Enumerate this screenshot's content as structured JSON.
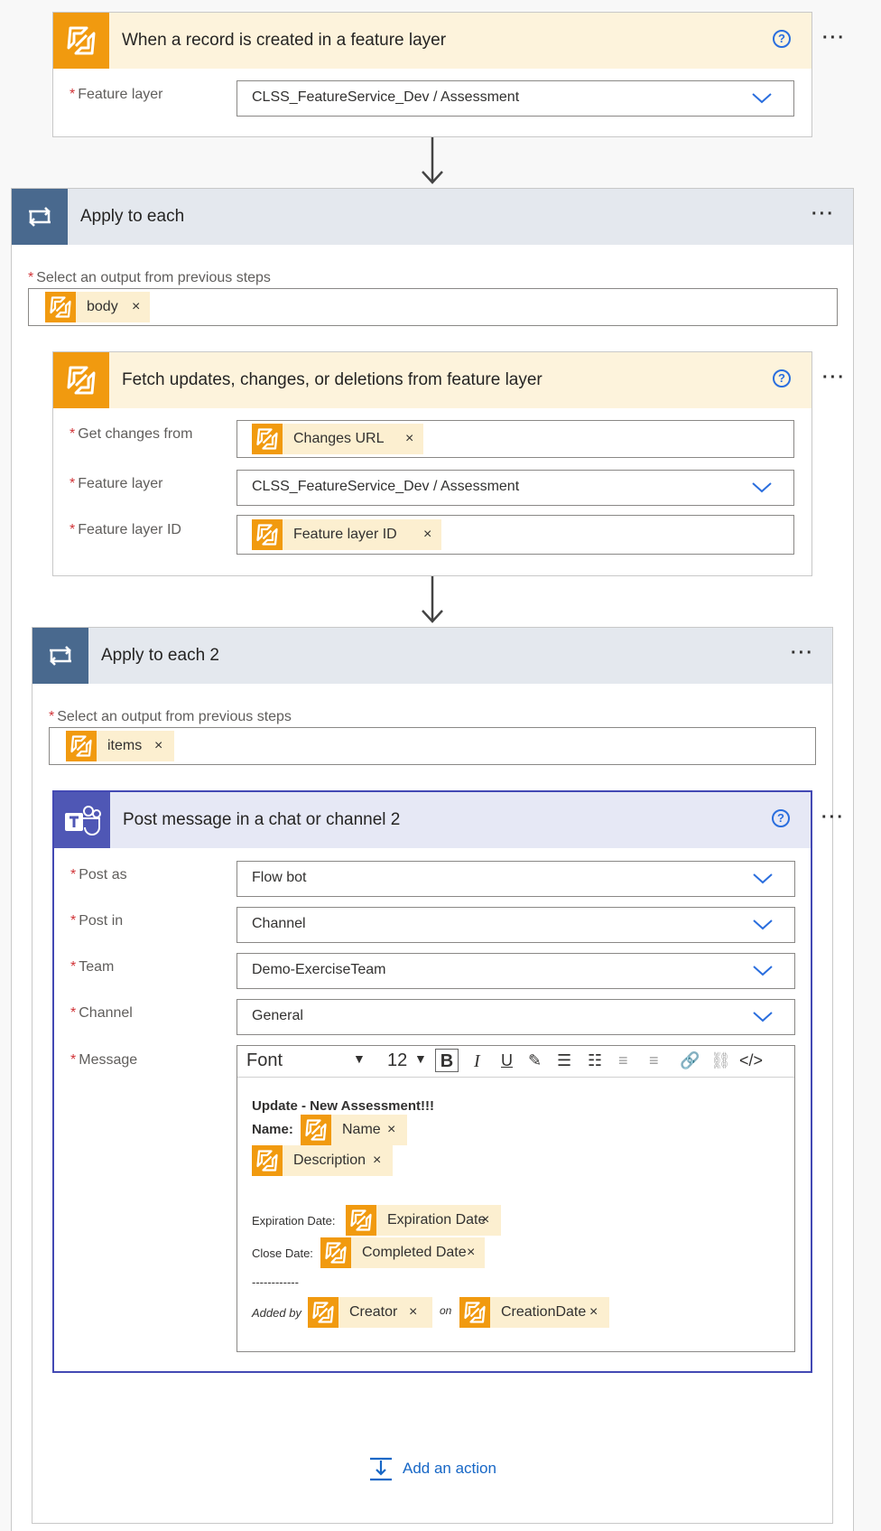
{
  "trigger": {
    "title": "When a record is created in a feature layer",
    "fields": [
      {
        "label": "Feature layer",
        "value": "CLSS_FeatureService_Dev / Assessment"
      }
    ]
  },
  "apply_each": {
    "title": "Apply to each",
    "select_label": "Select an output from previous steps",
    "token": "body"
  },
  "fetch": {
    "title": "Fetch updates, changes, or deletions from feature layer",
    "fields": [
      {
        "label": "Get changes from",
        "token": "Changes URL"
      },
      {
        "label": "Feature layer",
        "value": "CLSS_FeatureService_Dev / Assessment"
      },
      {
        "label": "Feature layer ID",
        "token": "Feature layer ID"
      }
    ]
  },
  "apply_each2": {
    "title": "Apply to each 2",
    "select_label": "Select an output from previous steps",
    "token": "items"
  },
  "post": {
    "title": "Post message in a chat or channel 2",
    "fields": [
      {
        "label": "Post as",
        "value": "Flow bot"
      },
      {
        "label": "Post in",
        "value": "Channel"
      },
      {
        "label": "Team",
        "value": "Demo-ExerciseTeam"
      },
      {
        "label": "Channel",
        "value": "General"
      }
    ],
    "message_label": "Message",
    "toolbar": {
      "font": "Font",
      "size": "12"
    },
    "message": {
      "heading": "Update - New Assessment!!!",
      "name_label": "Name:",
      "name_token": "Name",
      "description_token": "Description",
      "expiration_label": "Expiration Date:",
      "expiration_token": "Expiration Date",
      "close_label": "Close Date:",
      "close_token": "Completed Date",
      "separator": "------------",
      "added_by_label": "Added by",
      "creator_token": "Creator",
      "on_label": "on",
      "creation_token": "CreationDate"
    }
  },
  "add_action": "Add an action",
  "icons": {
    "connector": "arcgis-connector-icon",
    "loop": "loop-icon",
    "teams": "teams-icon",
    "help": "help-icon",
    "more": "more-icon",
    "chevron": "chevron-down-icon",
    "arrow": "down-arrow-icon"
  },
  "colors": {
    "connector": "#f19a0f",
    "loop": "#49698e",
    "teams": "#4f57b5",
    "accent": "#1767c6",
    "required": "#d13438"
  }
}
